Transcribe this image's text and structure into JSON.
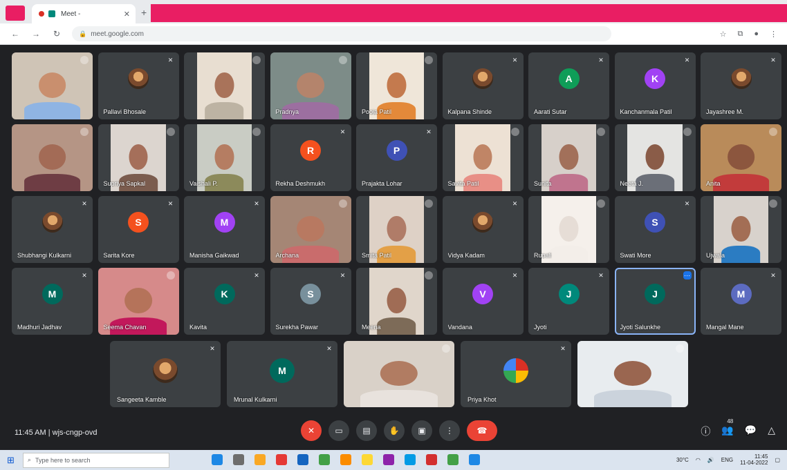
{
  "browser": {
    "tab_title": "Meet - ",
    "url": "meet.google.com",
    "icons": {
      "back": "arrow-left-icon",
      "forward": "arrow-right-icon",
      "reload": "reload-icon",
      "lock": "lock-icon"
    },
    "accent_color": "#e91e63"
  },
  "grid": [
    [
      {
        "type": "video",
        "name": "",
        "skin": "#c98f6e",
        "shirt": "#8fb4e3",
        "bg": "#cfc4b6",
        "full": true
      },
      {
        "type": "photo",
        "name": "Pallavi Bhosale"
      },
      {
        "type": "video",
        "name": "",
        "skin": "#a9735a",
        "shirt": "#bdb3a3",
        "bg": "#e8ded1"
      },
      {
        "type": "video",
        "name": "Pradnya",
        "skin": "#b4846c",
        "shirt": "#9c6fa0",
        "bg": "#7d8c88",
        "full": true
      },
      {
        "type": "video",
        "name": "Pooja Patil",
        "skin": "#c47a4e",
        "shirt": "#e3893a",
        "bg": "#efe6d9"
      },
      {
        "type": "photo",
        "name": "Kalpana Shinde"
      },
      {
        "type": "letter",
        "letter": "A",
        "color": "#0f9d58",
        "name": "Aarati Sutar"
      },
      {
        "type": "letter",
        "letter": "K",
        "color": "#a142f4",
        "name": "Kanchanmala Patil"
      },
      {
        "type": "photo",
        "name": "Jayashree M."
      }
    ],
    [
      {
        "type": "video",
        "name": "",
        "skin": "#a36b56",
        "shirt": "#6e3d44",
        "bg": "#b59585",
        "full": true
      },
      {
        "type": "video",
        "name": "Supriya Sapkal",
        "skin": "#a56f5a",
        "shirt": "#7b5c4e",
        "bg": "#dcd5cf"
      },
      {
        "type": "video",
        "name": "Vaishali P.",
        "skin": "#b57d62",
        "shirt": "#8c8a5b",
        "bg": "#c9ccc4"
      },
      {
        "type": "letter",
        "letter": "R",
        "color": "#f4511e",
        "name": "Rekha Deshmukh"
      },
      {
        "type": "letter",
        "letter": "P",
        "color": "#3f51b5",
        "name": "Prajakta Lohar"
      },
      {
        "type": "video",
        "name": "Savita Patil",
        "skin": "#c08566",
        "shirt": "#e88f86",
        "bg": "#ede1d4"
      },
      {
        "type": "video",
        "name": "Sunita",
        "skin": "#a2705a",
        "shirt": "#c0748e",
        "bg": "#d7d0ca"
      },
      {
        "type": "video",
        "name": "Neeta J.",
        "skin": "#8a5c48",
        "shirt": "#6b6f78",
        "bg": "#e4e4e2"
      },
      {
        "type": "video",
        "name": "Anita",
        "skin": "#8c563e",
        "shirt": "#c23b3b",
        "bg": "#b98b5a",
        "full": true
      }
    ],
    [
      {
        "type": "photo",
        "name": "Shubhangi Kulkarni"
      },
      {
        "type": "letter",
        "letter": "S",
        "color": "#f4511e",
        "name": "Sarita Kore"
      },
      {
        "type": "letter",
        "letter": "M",
        "color": "#a142f4",
        "name": "Manisha Gaikwad"
      },
      {
        "type": "video",
        "name": "Archana",
        "skin": "#b87961",
        "shirt": "#c96c6c",
        "bg": "#a58675",
        "full": true
      },
      {
        "type": "video",
        "name": "Smita Patil",
        "skin": "#b07c68",
        "shirt": "#e3a047",
        "bg": "#ded1c6"
      },
      {
        "type": "photo",
        "name": "Vidya Kadam"
      },
      {
        "type": "video",
        "name": "Rupali",
        "skin": "#e6ddd6",
        "shirt": "#f3eee9",
        "bg": "#f5f0eb"
      },
      {
        "type": "letter",
        "letter": "S",
        "color": "#3f51b5",
        "name": "Swati More"
      },
      {
        "type": "video",
        "name": "Ujwala",
        "skin": "#a36e55",
        "shirt": "#2b7cc2",
        "bg": "#d8d2cc"
      }
    ],
    [
      {
        "type": "letter",
        "letter": "M",
        "color": "#00695c",
        "name": "Madhuri Jadhav"
      },
      {
        "type": "video",
        "name": "Seema Chavan",
        "skin": "#b5735a",
        "shirt": "#c2185b",
        "bg": "#d68a8a",
        "full": true
      },
      {
        "type": "letter",
        "letter": "K",
        "color": "#00695c",
        "name": "Kavita"
      },
      {
        "type": "letter",
        "letter": "S",
        "color": "#78909c",
        "name": "Surekha Pawar"
      },
      {
        "type": "video",
        "name": "Meena",
        "skin": "#a06c55",
        "shirt": "#7d6b58",
        "bg": "#e0d6cb"
      },
      {
        "type": "letter",
        "letter": "V",
        "color": "#a142f4",
        "name": "Vandana"
      },
      {
        "type": "letter",
        "letter": "J",
        "color": "#00897b",
        "name": "Jyoti"
      },
      {
        "type": "letter",
        "letter": "J",
        "color": "#00695c",
        "name": "Jyoti Salunkhe",
        "active": true
      },
      {
        "type": "letter",
        "letter": "M",
        "color": "#5c6bc0",
        "name": "Mangal Mane"
      }
    ]
  ],
  "bottom_row": [
    {
      "type": "photo",
      "name": "Sangeeta Kamble"
    },
    {
      "type": "letter",
      "letter": "M",
      "color": "#00695c",
      "name": "Mrunal Kulkarni"
    },
    {
      "type": "video",
      "name": "",
      "skin": "#b17c62",
      "shirt": "#e8e2dd",
      "bg": "#d9d1c8",
      "full": true
    },
    {
      "type": "ball",
      "name": "Priya Khot"
    },
    {
      "type": "video",
      "name": "",
      "skin": "#9a6650",
      "shirt": "#cbd3dc",
      "bg": "#e8ecef",
      "full": true
    }
  ],
  "meeting_bar": {
    "time": "11:45 AM",
    "separator": "|",
    "meeting_code": "wjs-cngp-ovd",
    "controls": [
      {
        "id": "mic",
        "icon": "mic-off-icon",
        "glyph": "✕",
        "style": "red"
      },
      {
        "id": "camera",
        "icon": "camera-icon",
        "glyph": "▭",
        "style": ""
      },
      {
        "id": "captions",
        "icon": "captions-icon",
        "glyph": "▤",
        "style": ""
      },
      {
        "id": "raise-hand",
        "icon": "hand-icon",
        "glyph": "✋",
        "style": ""
      },
      {
        "id": "present",
        "icon": "present-icon",
        "glyph": "▣",
        "style": ""
      },
      {
        "id": "more",
        "icon": "more-icon",
        "glyph": "⋮",
        "style": ""
      },
      {
        "id": "end-call",
        "icon": "end-call-icon",
        "glyph": "☎",
        "style": "end"
      }
    ],
    "right": [
      {
        "id": "info",
        "icon": "info-icon",
        "glyph": "ⓘ"
      },
      {
        "id": "people",
        "icon": "people-icon",
        "glyph": "👥",
        "count": "48"
      },
      {
        "id": "chat",
        "icon": "chat-icon",
        "glyph": "💬"
      },
      {
        "id": "activities",
        "icon": "activities-icon",
        "glyph": "△"
      }
    ]
  },
  "taskbar": {
    "search_placeholder": "Type here to search",
    "apps": [
      "#1e88e5",
      "#6d6d6d",
      "#f9a825",
      "#e53935",
      "#1565c0",
      "#43a047",
      "#fb8c00",
      "#fdd835",
      "#8e24aa",
      "#039be5",
      "#d32f2f",
      "#43a047",
      "#1e88e5"
    ],
    "temp": "30°C",
    "lang": "ENG",
    "time": "11:45",
    "date": "11-04-2022"
  }
}
